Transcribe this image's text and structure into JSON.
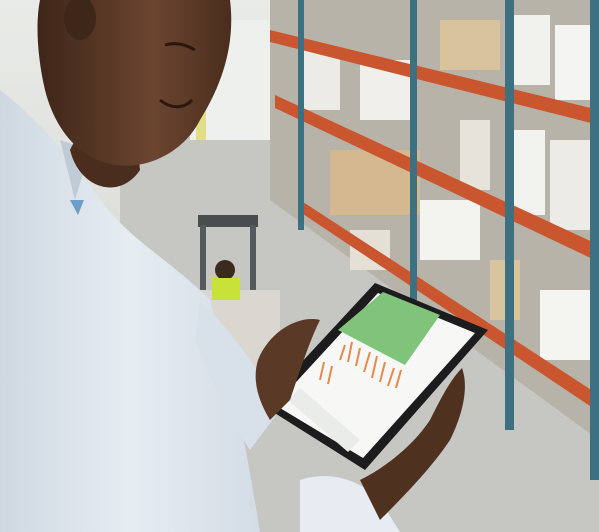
{
  "scene": {
    "subject": "man-holding-tablet",
    "setting": "warehouse-aisle",
    "tablet_screen": {
      "content": "bar-chart-dashboard",
      "accent_color": "#7fc47a",
      "bar_color": "#e58a4f"
    },
    "colors": {
      "shelf_beam": "#c9562e",
      "shelf_upright": "#3d7080",
      "shirt": "#dfe6ee",
      "skin": "#5a3a26",
      "floor": "#c4c5c0",
      "forklift_vest": "#c9e23a"
    }
  }
}
